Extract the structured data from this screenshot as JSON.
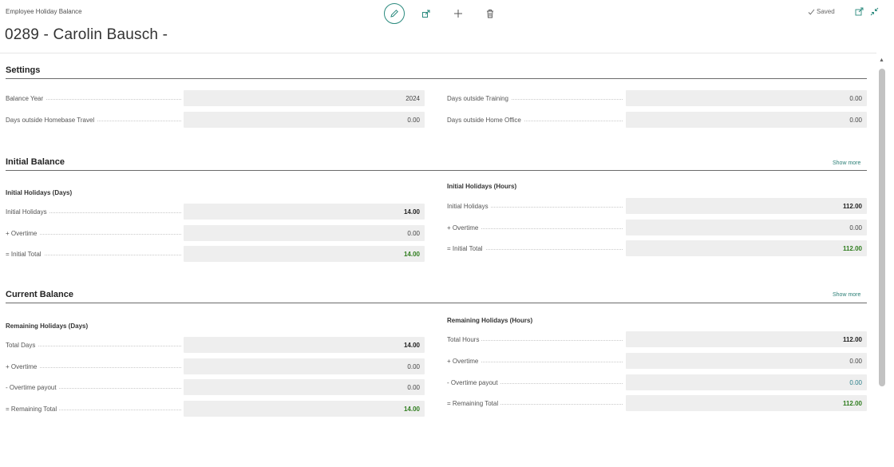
{
  "header": {
    "caption": "Employee Holiday Balance",
    "title": "0289 - Carolin Bausch -",
    "actions": [
      {
        "name": "edit-icon"
      },
      {
        "name": "share-icon"
      },
      {
        "name": "add-icon"
      },
      {
        "name": "delete-icon"
      }
    ],
    "saved_label": "Saved",
    "saved_icon": "checkmark-icon",
    "open_new_window_icon": "open-in-new-icon",
    "collapse_icon": "collapse-icon"
  },
  "settings": {
    "title": "Settings",
    "rows_left": [
      {
        "label": "Balance Year",
        "value": "2024"
      },
      {
        "label": "Days outside Homebase Travel",
        "value": "0.00"
      }
    ],
    "rows_right": [
      {
        "label": "Days outside Training",
        "value": "0.00"
      },
      {
        "label": "Days outside Home Office",
        "value": "0.00"
      }
    ]
  },
  "initial_balance": {
    "title": "Initial Balance",
    "show_more": "Show more",
    "days": {
      "title": "Initial Holidays (Days)",
      "rows": [
        {
          "label": "Initial Holidays",
          "value": "14.00",
          "style": "bold"
        },
        {
          "label": "+ Overtime",
          "value": "0.00",
          "style": "normal"
        },
        {
          "label": "= Initial Total",
          "value": "14.00",
          "style": "green"
        }
      ]
    },
    "hours": {
      "title": "Initial Holidays (Hours)",
      "rows": [
        {
          "label": "Initial Holidays",
          "value": "112.00",
          "style": "bold"
        },
        {
          "label": "+ Overtime",
          "value": "0.00",
          "style": "normal"
        },
        {
          "label": "= Initial Total",
          "value": "112.00",
          "style": "green"
        }
      ]
    }
  },
  "current_balance": {
    "title": "Current Balance",
    "show_more": "Show more",
    "days": {
      "title": "Remaining Holidays (Days)",
      "rows": [
        {
          "label": "Total Days",
          "value": "14.00",
          "style": "bold"
        },
        {
          "label": "+ Overtime",
          "value": "0.00",
          "style": "normal"
        },
        {
          "label": "- Overtime payout",
          "value": "0.00",
          "style": "normal"
        },
        {
          "label": "= Remaining Total",
          "value": "14.00",
          "style": "green"
        }
      ]
    },
    "hours": {
      "title": "Remaining Holidays (Hours)",
      "rows": [
        {
          "label": "Total Hours",
          "value": "112.00",
          "style": "bold"
        },
        {
          "label": "+ Overtime",
          "value": "0.00",
          "style": "normal"
        },
        {
          "label": "- Overtime payout",
          "value": "0.00",
          "style": "teal"
        },
        {
          "label": "= Remaining Total",
          "value": "112.00",
          "style": "green"
        }
      ]
    }
  },
  "colors": {
    "accent": "#2b8a7e",
    "positive_total": "#2f7d1e",
    "field_background": "#eeeeee"
  }
}
